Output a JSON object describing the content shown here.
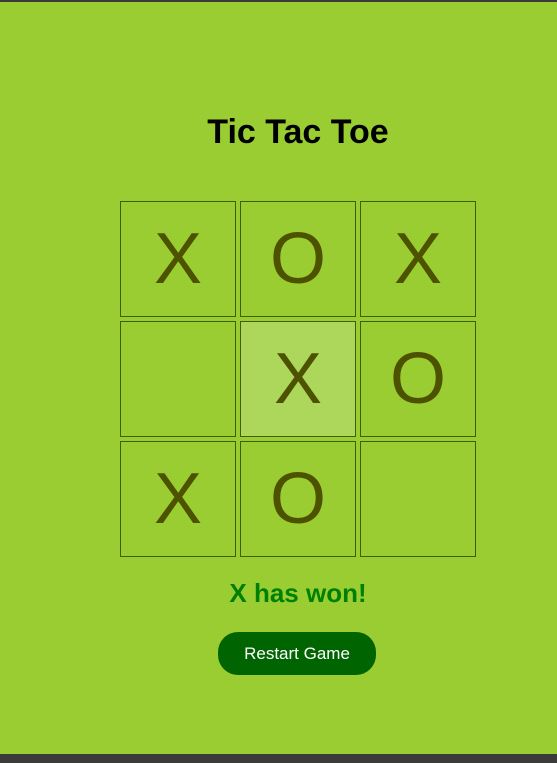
{
  "title": "Tic Tac Toe",
  "board": {
    "cells": [
      {
        "mark": "X"
      },
      {
        "mark": "O"
      },
      {
        "mark": "X"
      },
      {
        "mark": ""
      },
      {
        "mark": "X"
      },
      {
        "mark": "O"
      },
      {
        "mark": "X"
      },
      {
        "mark": "O"
      },
      {
        "mark": ""
      }
    ],
    "highlighted_cell": 4
  },
  "status": "X has won!",
  "restart_label": "Restart Game",
  "colors": {
    "background": "#9acd32",
    "cell_border": "#3f5f00",
    "mark": "#4d5200",
    "highlight": "#acd75a",
    "status": "#008000",
    "button": "#006400"
  }
}
